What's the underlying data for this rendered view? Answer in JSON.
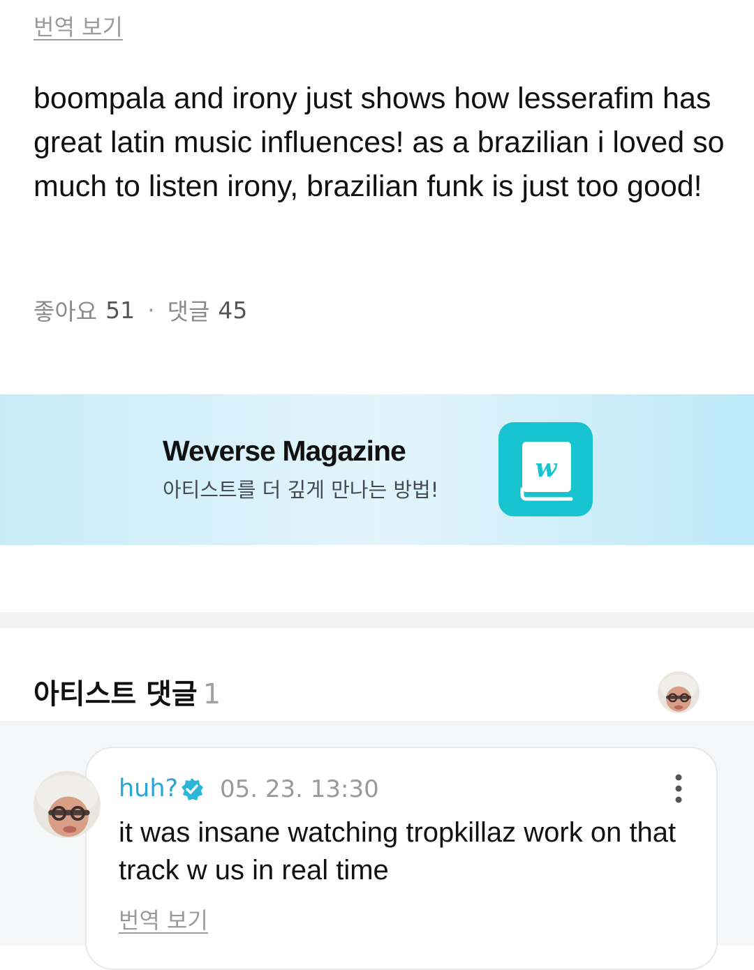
{
  "post": {
    "translate_label": "번역 보기",
    "body": "boompala and irony just shows how lesserafim has great latin music influences! as a brazilian i loved so much to listen irony, brazilian funk is just too good!",
    "likes_label": "좋아요",
    "likes_count": "51",
    "separator": "·",
    "comments_label": "댓글",
    "comments_count": "45"
  },
  "banner": {
    "title": "Weverse Magazine",
    "subtitle": "아티스트를 더 깊게 만나는 방법!",
    "icon": "weverse-magazine-book-icon",
    "icon_glyph": "w",
    "icon_color": "#18c3d0"
  },
  "artist_comments": {
    "title": "아티스트 댓글",
    "count": "1",
    "comment": {
      "author": "huh?",
      "verified": true,
      "verified_color": "#2bb6d9",
      "time": "05. 23. 13:30",
      "text": "it was insane watching tropkillaz work on that track w us in real time",
      "translate_label": "번역 보기"
    }
  },
  "colors": {
    "accent": "#2aa3d6",
    "muted_text": "#9a9a9a",
    "banner_gradient_start": "#c7ecf8",
    "banner_gradient_end": "#bde9f8"
  }
}
